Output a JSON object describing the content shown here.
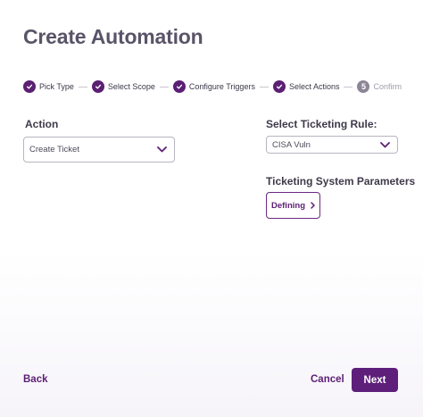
{
  "page": {
    "title": "Create Automation"
  },
  "stepper": {
    "steps": [
      {
        "label": "Pick Type",
        "status": "complete"
      },
      {
        "label": "Select Scope",
        "status": "complete"
      },
      {
        "label": "Configure Triggers",
        "status": "complete"
      },
      {
        "label": "Select Actions",
        "status": "complete"
      },
      {
        "label": "Confirm",
        "status": "pending",
        "number": "5"
      }
    ]
  },
  "action": {
    "label": "Action",
    "selected": "Create Ticket"
  },
  "ticketing_rule": {
    "label": "Select Ticketing Rule:",
    "selected": "CISA Vuln"
  },
  "ticketing_params": {
    "label": "Ticketing System Parameters",
    "button_label": "Defining"
  },
  "footer": {
    "back_label": "Back",
    "cancel_label": "Cancel",
    "next_label": "Next"
  },
  "colors": {
    "primary": "#5b1f73",
    "pending_step": "#8b8597",
    "title": "#5a5468"
  }
}
